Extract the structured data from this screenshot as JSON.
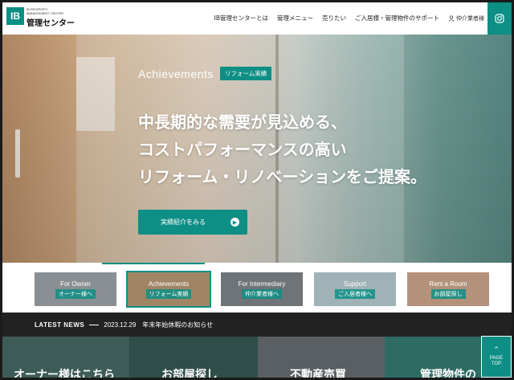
{
  "header": {
    "logo_mark": "IB",
    "logo_sub": "IB PROPERTY MANAGEMENT CENTER",
    "logo_main": "管理センター",
    "nav": [
      "IB管理センターとは",
      "管理メニュー",
      "売りたい",
      "ご入居様・管理物件のサポート"
    ],
    "agent_label": "仲介業者様",
    "instagram_icon": "instagram-icon"
  },
  "hero": {
    "label_en": "Achievements",
    "label_jp": "リフォーム実績",
    "heading_lines": [
      "中長期的な需要が見込める、",
      "コストパフォーマンスの高い",
      "リフォーム・リノベーションをご提案。"
    ],
    "button_label": "実績紹介をみる",
    "button_icon": "arrow-right-icon"
  },
  "categories": [
    {
      "en": "For Owner",
      "jp": "オーナー様へ",
      "active": false,
      "color": "#8a8f93"
    },
    {
      "en": "Achievements",
      "jp": "リフォーム実績",
      "active": true,
      "color": "#a08565"
    },
    {
      "en": "For Intermediary",
      "jp": "仲介業者様へ",
      "active": false,
      "color": "#6e7478"
    },
    {
      "en": "Support",
      "jp": "ご入居者様へ",
      "active": false,
      "color": "#9fb2b6"
    },
    {
      "en": "Rent a Room",
      "jp": "お部屋探し",
      "active": false,
      "color": "#b3917a"
    }
  ],
  "news": {
    "title": "LATEST NEWS",
    "date": "2023.12.29",
    "text": "年末年始休暇のお知らせ"
  },
  "tiles": [
    {
      "text": "オーナー様はこちら",
      "color": "#3d5c57"
    },
    {
      "text": "お部屋探し",
      "color": "#2f4d49"
    },
    {
      "text": "不動産売買",
      "color": "#5a5f63"
    },
    {
      "text": "管理物件の",
      "color": "#2d6b63"
    }
  ],
  "pagetop": {
    "line1": "PAGE",
    "line2": "TOP"
  },
  "colors": {
    "accent": "#0e8f86",
    "news_bg": "#222222"
  }
}
